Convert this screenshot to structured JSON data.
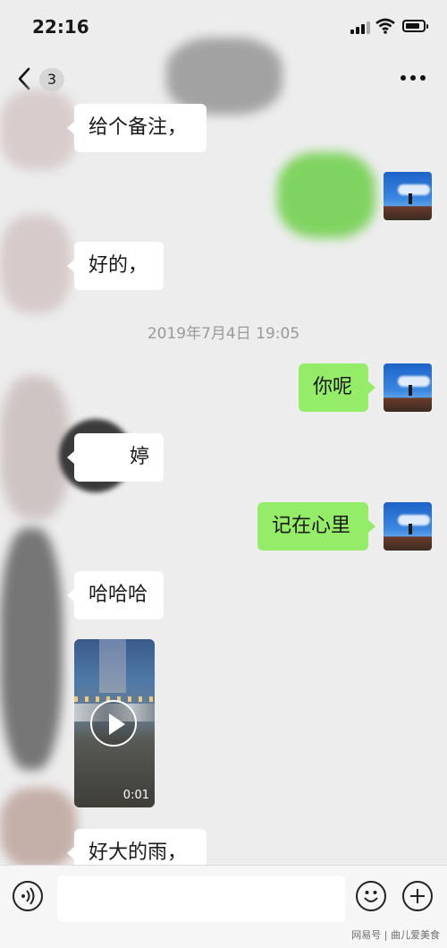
{
  "status_bar": {
    "time": "22:16"
  },
  "nav": {
    "unread_count": "3"
  },
  "messages": [
    {
      "side": "in",
      "text": "给个备注，"
    },
    {
      "side": "out",
      "text": ""
    },
    {
      "side": "in",
      "text": "好的，"
    },
    {
      "side": "time",
      "text": "2019年7月4日 19:05"
    },
    {
      "side": "out",
      "text": "你呢"
    },
    {
      "side": "in",
      "text": "婷"
    },
    {
      "side": "out",
      "text": "记在心里"
    },
    {
      "side": "in",
      "text": "哈哈哈"
    },
    {
      "side": "in",
      "type": "video",
      "duration": "0:01"
    },
    {
      "side": "in",
      "text": "好大的雨，"
    }
  ],
  "icons": {
    "back": "chevron-left-icon",
    "more": "more-dots-icon",
    "voice": "voice-icon",
    "emoji": "emoji-icon",
    "plus": "plus-icon",
    "video_play": "play-icon"
  },
  "colors": {
    "background": "#ededed",
    "outgoing_bubble": "#95ec69",
    "incoming_bubble": "#ffffff",
    "timestamp": "#9a9a9a"
  },
  "watermark": "网易号 | 曲儿爱美食"
}
